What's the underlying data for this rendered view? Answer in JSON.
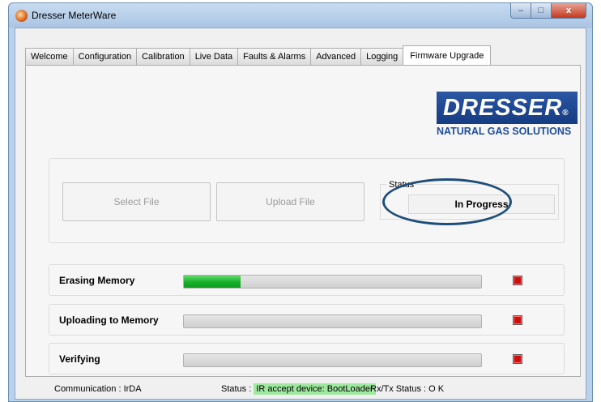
{
  "window": {
    "title": "Dresser MeterWare",
    "controls": {
      "minimize": "–",
      "maximize": "□",
      "close": "x"
    }
  },
  "tabs": [
    "Welcome",
    "Configuration",
    "Calibration",
    "Live Data",
    "Faults & Alarms",
    "Advanced",
    "Logging",
    "Firmware Upgrade"
  ],
  "active_tab": "Firmware Upgrade",
  "logo": {
    "brand": "DRESSER",
    "reg": "®",
    "sub": "NATURAL GAS SOLUTIONS"
  },
  "file_actions": {
    "select_label": "Select File",
    "upload_label": "Upload File",
    "status_label": "Status",
    "status_value": "In Progress"
  },
  "progress_rows": [
    {
      "label": "Erasing Memory",
      "progress": 0.19
    },
    {
      "label": "Uploading to Memory",
      "progress": 0
    },
    {
      "label": "Verifying",
      "progress": 0
    }
  ],
  "statusbar": {
    "communication": "Communication : IrDA",
    "status_prefix": "Status :",
    "status_value": "IR accept device: BootLoader",
    "rxtx": "Rx/Tx Status : O K"
  },
  "colors": {
    "progress_fill": "#17b02a",
    "indicator": "#cc1010",
    "highlight_ellipse": "#1f4e79",
    "status_ok_bg": "#9fe89f"
  }
}
